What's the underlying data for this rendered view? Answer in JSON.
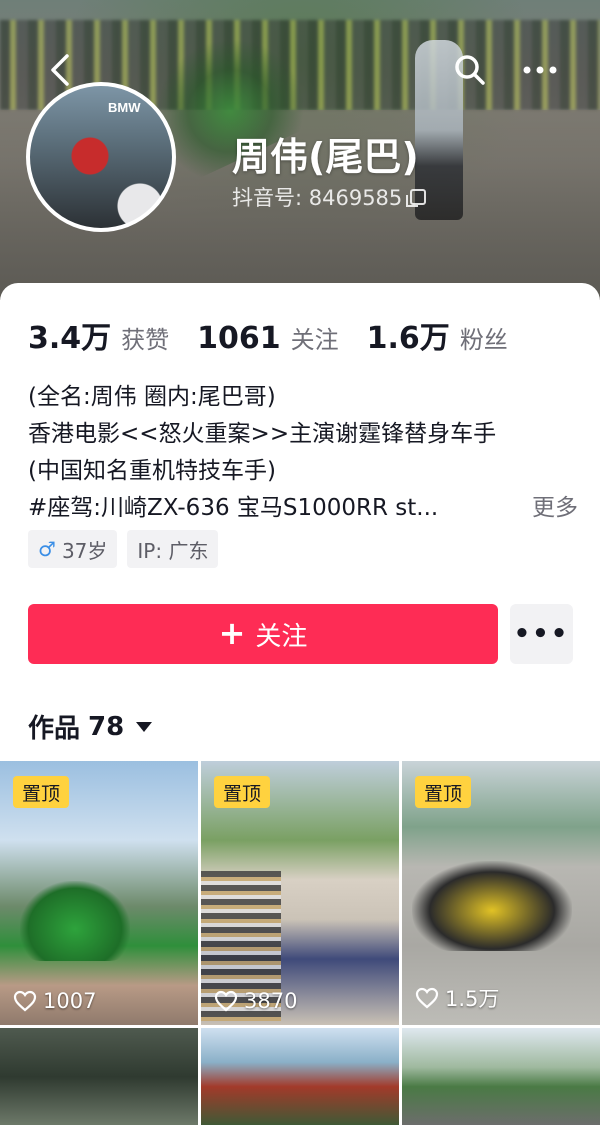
{
  "profile": {
    "name": "周伟(尾巴)",
    "account_id": "抖音号: 8469585",
    "avatar_logo_text": "BMW"
  },
  "stats": [
    {
      "value": "3.4万",
      "label": "获赞"
    },
    {
      "value": "1061",
      "label": "关注"
    },
    {
      "value": "1.6万",
      "label": "粉丝"
    }
  ],
  "bio": {
    "lines": [
      "(全名:周伟 圈内:尾巴哥)",
      "香港电影<<怒火重案>>主演谢霆锋替身车手",
      "(中国知名重机特技车手)",
      "#座驾:川崎ZX-636   宝马S1000RR   st..."
    ],
    "more_label": "更多"
  },
  "tags": {
    "age": "37岁",
    "ip": "IP: 广东"
  },
  "actions": {
    "follow_label": "关注",
    "more_label": "•••"
  },
  "works": {
    "label": "作品",
    "count": "78"
  },
  "videos": [
    {
      "pinned_label": "置顶",
      "likes": "1007"
    },
    {
      "pinned_label": "置顶",
      "likes": "3870"
    },
    {
      "pinned_label": "置顶",
      "likes": "1.5万"
    }
  ],
  "icons": [
    "back-icon",
    "search-icon",
    "more-icon",
    "copy-icon",
    "male-icon",
    "plus-icon",
    "caret-down-icon",
    "heart-icon"
  ],
  "colors": {
    "accent": "#fe2c55",
    "pin_badge": "#ffd23f",
    "male": "#3a8ee6"
  }
}
